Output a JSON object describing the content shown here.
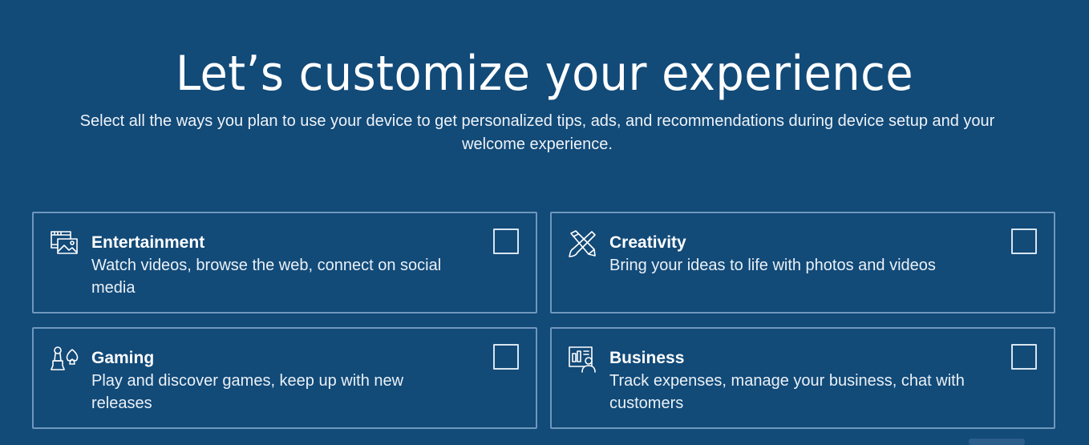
{
  "header": {
    "title": "Let’s customize your experience",
    "subtitle": "Select all the ways you plan to use your device to get personalized tips, ads, and recommendations during device setup and your welcome experience."
  },
  "options": [
    {
      "title": "Entertainment",
      "description": "Watch videos, browse the web, connect on social media",
      "icon": "entertainment-icon",
      "checked": false
    },
    {
      "title": "Creativity",
      "description": "Bring your ideas to life with photos and videos",
      "icon": "creativity-icon",
      "checked": false
    },
    {
      "title": "Gaming",
      "description": "Play and discover games, keep up with new releases",
      "icon": "gaming-icon",
      "checked": false
    },
    {
      "title": "Business",
      "description": "Track expenses, manage your business, chat with customers",
      "icon": "business-icon",
      "checked": false
    }
  ],
  "colors": {
    "background": "#124a78",
    "card_border": "#6f98bd",
    "text": "#ffffff"
  }
}
